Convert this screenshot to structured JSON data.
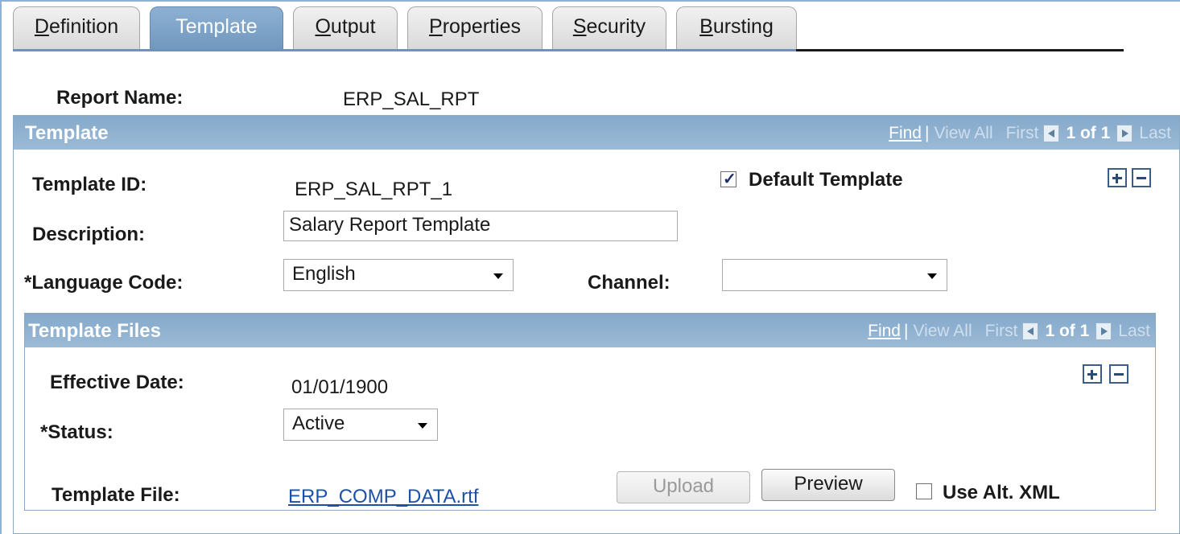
{
  "tabs": [
    {
      "label_pre": "",
      "label_u": "D",
      "label_post": "efinition"
    },
    {
      "label_pre": "Template",
      "label_u": "",
      "label_post": ""
    },
    {
      "label_pre": "",
      "label_u": "O",
      "label_post": "utput"
    },
    {
      "label_pre": "",
      "label_u": "P",
      "label_post": "roperties"
    },
    {
      "label_pre": "",
      "label_u": "S",
      "label_post": "ecurity"
    },
    {
      "label_pre": "",
      "label_u": "B",
      "label_post": "ursting"
    }
  ],
  "report": {
    "name_label": "Report Name:",
    "name_value": "ERP_SAL_RPT"
  },
  "template_group": {
    "title": "Template",
    "nav": {
      "find": "Find",
      "sep": "|",
      "view_all": "View All",
      "first": "First",
      "count": "1 of 1",
      "last": "Last"
    },
    "template_id_label": "Template ID:",
    "template_id_value": "ERP_SAL_RPT_1",
    "default_template_label": "Default Template",
    "default_template_checked": true,
    "description_label": "Description:",
    "description_value": "Salary Report Template",
    "language_label": "*Language Code:",
    "language_value": "English",
    "channel_label": "Channel:",
    "channel_value": ""
  },
  "files_group": {
    "title": "Template Files",
    "nav": {
      "find": "Find",
      "sep": "|",
      "view_all": "View All",
      "first": "First",
      "count": "1 of 1",
      "last": "Last"
    },
    "effective_date_label": "Effective Date:",
    "effective_date_value": "01/01/1900",
    "status_label": "*Status:",
    "status_value": "Active",
    "template_file_label": "Template File:",
    "template_file_value": "ERP_COMP_DATA.rtf",
    "upload_label": "Upload",
    "preview_label": "Preview",
    "use_alt_xml_label": "Use Alt. XML",
    "use_alt_xml_checked": false
  },
  "colors": {
    "tab_active": "#7ea3c8",
    "group_header": "#8fb0d0",
    "link": "#1d50a8"
  }
}
